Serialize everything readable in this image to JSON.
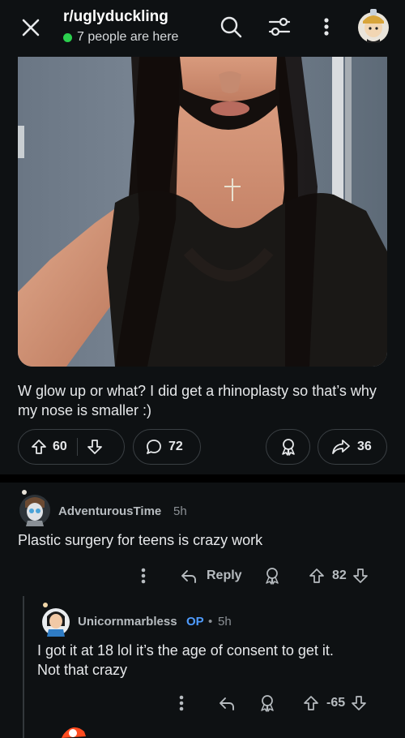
{
  "header": {
    "subreddit": "r/uglyduckling",
    "online_text": "7 people are here",
    "colors": {
      "online_dot": "#2bd04e",
      "op_tag": "#4f9cff"
    },
    "icons": [
      "close-icon",
      "search-icon",
      "filter-icon",
      "more-vertical-icon",
      "user-avatar"
    ]
  },
  "post": {
    "caption": "W glow up or what? I did get a rhinoplasty so that’s why my nose is smaller :)",
    "score": "60",
    "comments": "72",
    "shares": "36"
  },
  "comments": [
    {
      "user": "AdventurousTime",
      "time": "5h",
      "text": "Plastic surgery for teens is crazy work",
      "reply_label": "Reply",
      "score": "82"
    },
    {
      "user": "Unicornmarbless",
      "op": "OP",
      "sep": "•",
      "time": "5h",
      "text_line1": "I got it at 18 lol it’s the age of consent to get it.",
      "text_line2": "Not that crazy",
      "score": "-65"
    }
  ]
}
